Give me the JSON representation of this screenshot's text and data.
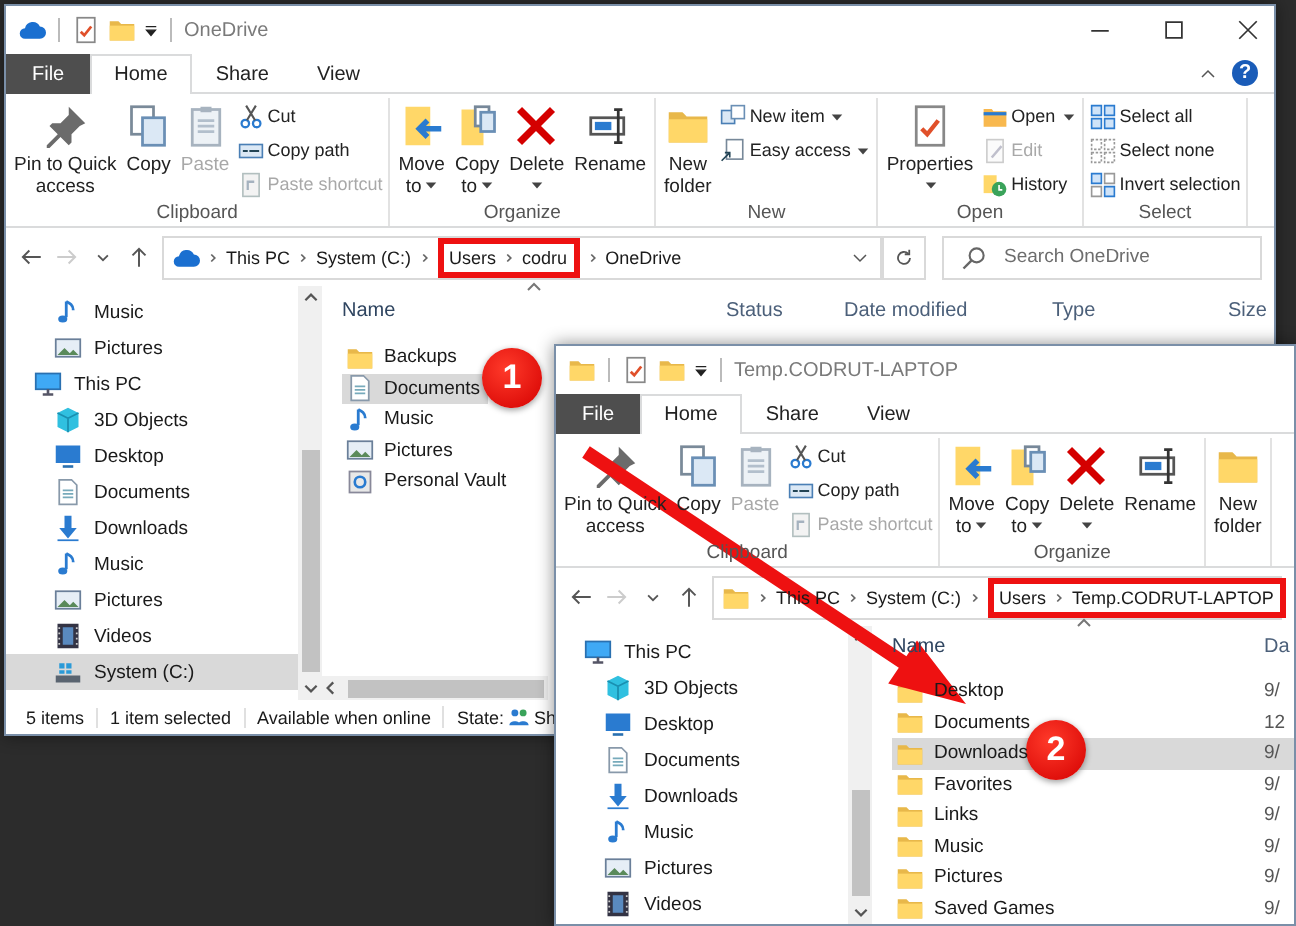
{
  "windows": [
    {
      "title": "OneDrive",
      "kind": "cloud",
      "tabs": [
        {
          "label": "File",
          "kind": "file",
          "selected": false
        },
        {
          "label": "Home",
          "kind": "tab",
          "selected": true
        },
        {
          "label": "Share",
          "kind": "tab",
          "selected": false
        },
        {
          "label": "View",
          "kind": "tab",
          "selected": false
        }
      ],
      "help": "?",
      "ribbon": [
        {
          "label": "Clipboard",
          "columns": [
            [
              {
                "label": "Pin to Quick\naccess",
                "kind": "pin",
                "disabled": false,
                "caret": false
              }
            ],
            [
              {
                "label": "Copy",
                "kind": "copy",
                "disabled": false,
                "caret": false
              }
            ],
            [
              {
                "label": "Paste",
                "kind": "paste",
                "disabled": true,
                "caret": false
              }
            ],
            [
              {
                "label": "Cut",
                "kind": "cut",
                "disabled": false,
                "caret": false
              },
              {
                "label": "Copy path",
                "kind": "copypath",
                "disabled": false,
                "caret": false
              },
              {
                "label": "Paste shortcut",
                "kind": "pasteshortcut",
                "disabled": true,
                "caret": false
              }
            ]
          ]
        },
        {
          "label": "Organize",
          "columns": [
            [
              {
                "label": "Move\nto",
                "kind": "move",
                "disabled": false,
                "caret": true
              }
            ],
            [
              {
                "label": "Copy\nto",
                "kind": "copyto",
                "disabled": false,
                "caret": true
              }
            ],
            [
              {
                "label": "Delete",
                "kind": "delete",
                "disabled": false,
                "caret": true
              }
            ],
            [
              {
                "label": "Rename",
                "kind": "rename",
                "disabled": false,
                "caret": false
              }
            ]
          ]
        },
        {
          "label": "New",
          "columns": [
            [
              {
                "label": "New\nfolder",
                "kind": "folder",
                "disabled": false,
                "caret": false
              }
            ],
            [
              {
                "label": "New item",
                "kind": "newitem",
                "disabled": false,
                "caret": true
              },
              {
                "label": "Easy access",
                "kind": "easyaccess",
                "disabled": false,
                "caret": true
              }
            ]
          ]
        },
        {
          "label": "Open",
          "columns": [
            [
              {
                "label": "Properties",
                "kind": "properties",
                "disabled": false,
                "caret": true
              }
            ],
            [
              {
                "label": "Open",
                "kind": "open",
                "disabled": false,
                "caret": true
              },
              {
                "label": "Edit",
                "kind": "edit",
                "disabled": true,
                "caret": false
              },
              {
                "label": "History",
                "kind": "history",
                "disabled": false,
                "caret": false
              }
            ]
          ]
        },
        {
          "label": "Select",
          "columns": [
            [
              {
                "label": "Select all",
                "kind": "selectall",
                "disabled": false,
                "caret": false
              },
              {
                "label": "Select none",
                "kind": "selectnone",
                "disabled": false,
                "caret": false
              },
              {
                "label": "Invert selection",
                "kind": "invert",
                "disabled": false,
                "caret": false
              }
            ]
          ]
        }
      ],
      "nav_buttons": [
        {
          "kind": "back",
          "disabled": false
        },
        {
          "kind": "forward",
          "disabled": true
        },
        {
          "kind": "recent",
          "disabled": false
        },
        {
          "kind": "up",
          "disabled": false
        }
      ],
      "address": {
        "crumbs": [
          {
            "label": "This PC",
            "annotated": false
          },
          {
            "label": "System (C:)",
            "annotated": false
          },
          {
            "label": "Users",
            "annotated": true
          },
          {
            "label": "codru",
            "annotated": true
          },
          {
            "label": "OneDrive",
            "annotated": false
          }
        ]
      },
      "search": {
        "placeholder": "Search OneDrive"
      },
      "nav": [
        {
          "children": [
            {
              "label": "Music",
              "kind": "music",
              "selected": false
            },
            {
              "label": "Pictures",
              "kind": "pictures",
              "selected": false
            }
          ]
        },
        {
          "label": "This PC",
          "kind": "pc",
          "selected": false,
          "children": [
            {
              "label": "3D Objects",
              "kind": "objects",
              "selected": false
            },
            {
              "label": "Desktop",
              "kind": "desktop",
              "selected": false
            },
            {
              "label": "Documents",
              "kind": "documents",
              "selected": false
            },
            {
              "label": "Downloads",
              "kind": "downloads",
              "selected": false
            },
            {
              "label": "Music",
              "kind": "music",
              "selected": false
            },
            {
              "label": "Pictures",
              "kind": "pictures",
              "selected": false
            },
            {
              "label": "Videos",
              "kind": "videos",
              "selected": false
            },
            {
              "label": "System (C:)",
              "kind": "drive",
              "selected": true
            }
          ]
        }
      ],
      "columns": [
        {
          "label": "Name",
          "sorted": true
        },
        {
          "label": "Status",
          "sorted": false
        },
        {
          "label": "Date modified",
          "sorted": false
        },
        {
          "label": "Type",
          "sorted": false
        },
        {
          "label": "Size",
          "sorted": false
        }
      ],
      "rows": [
        {
          "name": "Backups",
          "kind": "folder",
          "selected": false
        },
        {
          "name": "Documents",
          "kind": "documents",
          "selected": true
        },
        {
          "name": "Music",
          "kind": "music",
          "selected": false
        },
        {
          "name": "Pictures",
          "kind": "pictures",
          "selected": false
        },
        {
          "name": "Personal Vault",
          "kind": "vault",
          "selected": false
        }
      ],
      "status_bar": {
        "items": [
          "5 items",
          "1 item selected",
          "Available when online"
        ],
        "state_label": "State:",
        "state_value": "Sh"
      }
    },
    {
      "title": "Temp.CODRUT-LAPTOP",
      "kind": "folder",
      "tabs": [
        {
          "label": "File",
          "kind": "file",
          "selected": false
        },
        {
          "label": "Home",
          "kind": "tab",
          "selected": true
        },
        {
          "label": "Share",
          "kind": "tab",
          "selected": false
        },
        {
          "label": "View",
          "kind": "tab",
          "selected": false
        }
      ],
      "ribbon": [
        {
          "label": "Clipboard",
          "columns": [
            [
              {
                "label": "Pin to Quick\naccess",
                "kind": "pin",
                "disabled": false,
                "caret": false
              }
            ],
            [
              {
                "label": "Copy",
                "kind": "copy",
                "disabled": false,
                "caret": false
              }
            ],
            [
              {
                "label": "Paste",
                "kind": "paste",
                "disabled": true,
                "caret": false
              }
            ],
            [
              {
                "label": "Cut",
                "kind": "cut",
                "disabled": false,
                "caret": false
              },
              {
                "label": "Copy path",
                "kind": "copypath",
                "disabled": false,
                "caret": false
              },
              {
                "label": "Paste shortcut",
                "kind": "pasteshortcut",
                "disabled": true,
                "caret": false
              }
            ]
          ]
        },
        {
          "label": "Organize",
          "columns": [
            [
              {
                "label": "Move\nto",
                "kind": "move",
                "disabled": false,
                "caret": true
              }
            ],
            [
              {
                "label": "Copy\nto",
                "kind": "copyto",
                "disabled": false,
                "caret": true
              }
            ],
            [
              {
                "label": "Delete",
                "kind": "delete",
                "disabled": false,
                "caret": true
              }
            ],
            [
              {
                "label": "Rename",
                "kind": "rename",
                "disabled": false,
                "caret": false
              }
            ]
          ]
        },
        {
          "columns": [
            [
              {
                "label": "New\nfolder",
                "kind": "folder",
                "disabled": false,
                "caret": false
              }
            ]
          ]
        }
      ],
      "nav_buttons": [
        {
          "kind": "back",
          "disabled": false
        },
        {
          "kind": "forward",
          "disabled": true
        },
        {
          "kind": "recent",
          "disabled": false
        },
        {
          "kind": "up",
          "disabled": false
        }
      ],
      "address": {
        "crumbs": [
          {
            "label": "This PC",
            "annotated": false
          },
          {
            "label": "System (C:)",
            "annotated": false
          },
          {
            "label": "Users",
            "annotated": true
          },
          {
            "label": "Temp.CODRUT-LAPTOP",
            "annotated": true
          }
        ]
      },
      "nav": [
        {
          "label": "This PC",
          "kind": "pc",
          "selected": false,
          "children": [
            {
              "label": "3D Objects",
              "kind": "objects",
              "selected": false
            },
            {
              "label": "Desktop",
              "kind": "desktop",
              "selected": false
            },
            {
              "label": "Documents",
              "kind": "documents",
              "selected": false
            },
            {
              "label": "Downloads",
              "kind": "downloads",
              "selected": false
            },
            {
              "label": "Music",
              "kind": "music",
              "selected": false
            },
            {
              "label": "Pictures",
              "kind": "pictures",
              "selected": false
            },
            {
              "label": "Videos",
              "kind": "videos",
              "selected": false
            }
          ]
        }
      ],
      "columns": [
        {
          "label": "Name",
          "sorted": true
        },
        {
          "label": "Da",
          "sorted": false
        }
      ],
      "rows": [
        {
          "name": "Desktop",
          "kind": "folder",
          "selected": false,
          "cells": [
            "9/"
          ]
        },
        {
          "name": "Documents",
          "kind": "folder",
          "selected": false,
          "cells": [
            "12"
          ]
        },
        {
          "name": "Downloads",
          "kind": "folder",
          "selected": true,
          "cells": [
            "9/"
          ]
        },
        {
          "name": "Favorites",
          "kind": "folder",
          "selected": false,
          "cells": [
            "9/"
          ]
        },
        {
          "name": "Links",
          "kind": "folder",
          "selected": false,
          "cells": [
            "9/"
          ]
        },
        {
          "name": "Music",
          "kind": "folder",
          "selected": false,
          "cells": [
            "9/"
          ]
        },
        {
          "name": "Pictures",
          "kind": "folder",
          "selected": false,
          "cells": [
            "9/"
          ]
        },
        {
          "name": "Saved Games",
          "kind": "folder",
          "selected": false,
          "cells": [
            "9/"
          ]
        }
      ]
    }
  ],
  "markers": [
    {
      "label": "1"
    },
    {
      "label": "2"
    }
  ]
}
